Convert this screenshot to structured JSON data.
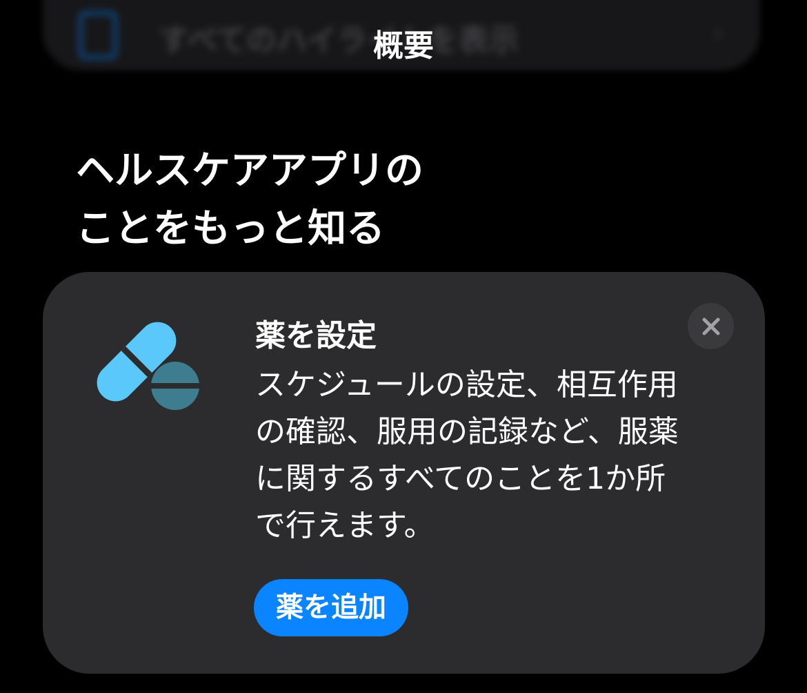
{
  "background_row": {
    "label": "すべてのハイライトを表示",
    "icon": "highlights-icon",
    "chevron": "›"
  },
  "nav": {
    "title": "概要"
  },
  "section": {
    "heading_lines": [
      "ヘルスケアアプリの",
      "ことをもっと知る"
    ]
  },
  "card": {
    "icon": "pills-icon",
    "title": "薬を設定",
    "body_lines": [
      "スケジュールの設定、相互作用",
      "の確認、服用の記録など、服薬",
      "に関するすべてのことを1か所",
      "で行えます。"
    ],
    "action_label": "薬を追加",
    "close_icon": "close-icon"
  },
  "colors": {
    "background": "#000000",
    "card": "#2c2c2e",
    "accent": "#0a84ff",
    "pill_light": "#5ac8fa",
    "pill_dark": "#3d7d8f"
  }
}
